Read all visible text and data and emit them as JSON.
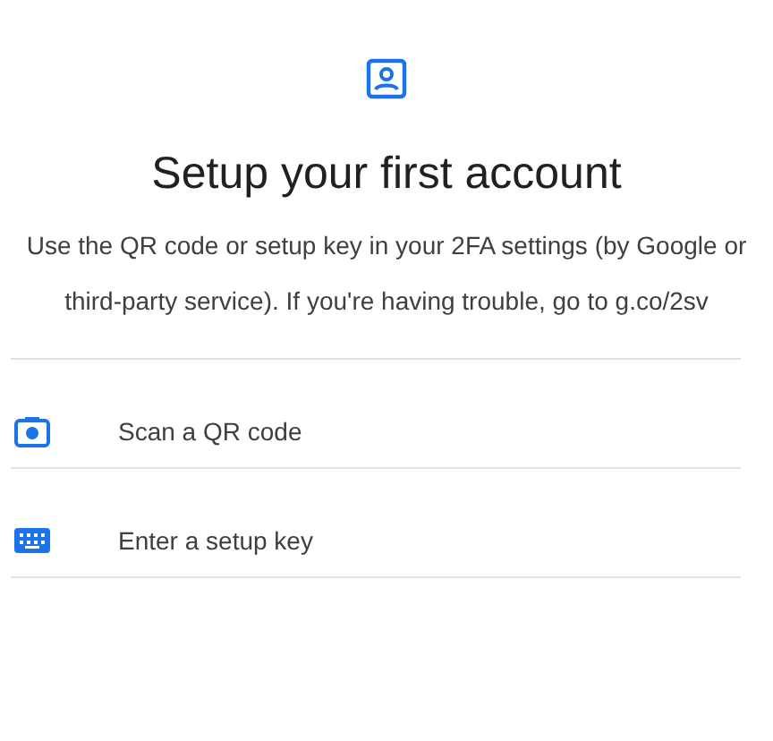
{
  "title": "Setup your first account",
  "description": "Use the QR code or setup key in your 2FA settings (by Google or third-party service). If you're having trouble, go to g.co/2sv",
  "options": [
    {
      "kind": "camera",
      "label": "Scan a QR code"
    },
    {
      "kind": "keyboard",
      "label": "Enter a setup key"
    }
  ]
}
